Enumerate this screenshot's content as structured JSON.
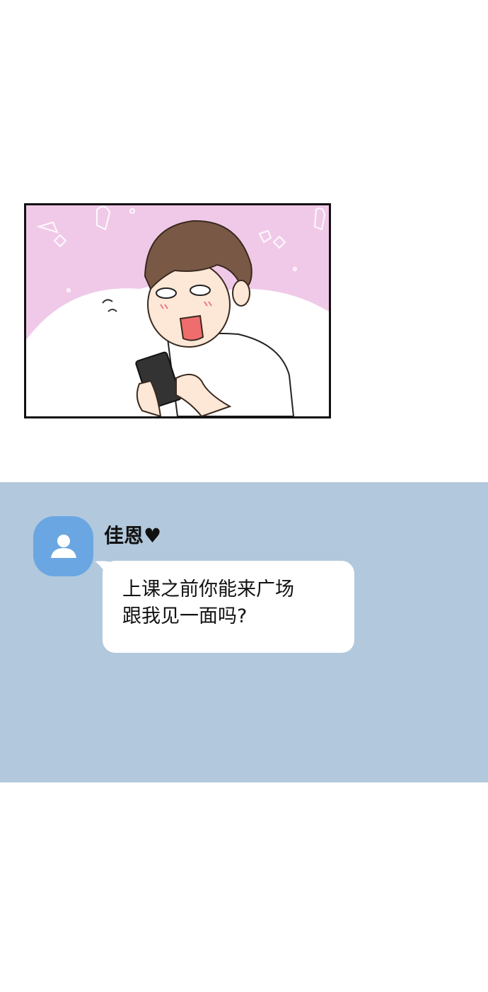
{
  "comic_panel": {
    "illustration": "boy-looking-at-phone-excited",
    "background_color": "#f0c9e8",
    "border_color": "#111111"
  },
  "chat": {
    "background_color": "#b2c8dc",
    "avatar_color": "#6aa6e2",
    "avatar_icon": "person-icon",
    "sender_name": "佳恩♥",
    "message_lines": [
      "上课之前你能来广场",
      "跟我见一面吗?"
    ]
  }
}
